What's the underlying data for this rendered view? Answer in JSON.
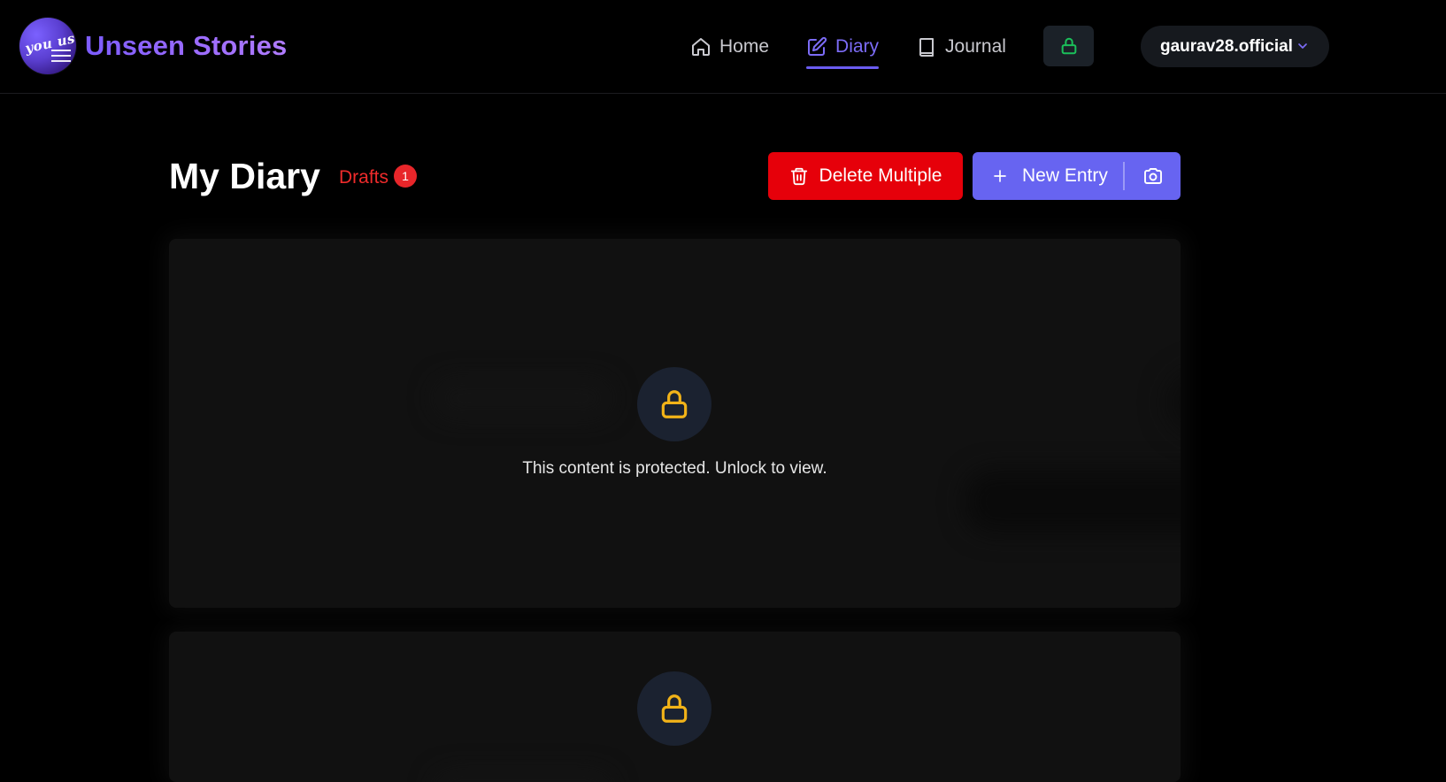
{
  "brand": {
    "logo_text": "you us",
    "name": "Unseen Stories"
  },
  "nav": {
    "items": [
      {
        "label": "Home",
        "icon": "home-icon",
        "active": false
      },
      {
        "label": "Diary",
        "icon": "edit-icon",
        "active": true
      },
      {
        "label": "Journal",
        "icon": "book-icon",
        "active": false
      }
    ],
    "lock_icon": "lock-icon",
    "user": {
      "name": "gaurav28.official",
      "icon": "chevron-down-icon"
    }
  },
  "page": {
    "title": "My Diary",
    "drafts_label": "Drafts",
    "drafts_count": "1",
    "delete_label": "Delete Multiple",
    "new_entry_label": "New Entry"
  },
  "cards": [
    {
      "message": "This content is protected. Unlock to view."
    },
    {
      "message": ""
    }
  ],
  "colors": {
    "accent": "#6764f1",
    "danger": "#e6000a",
    "lock_yellow": "#f2b318",
    "lock_green": "#1bbf5a"
  }
}
